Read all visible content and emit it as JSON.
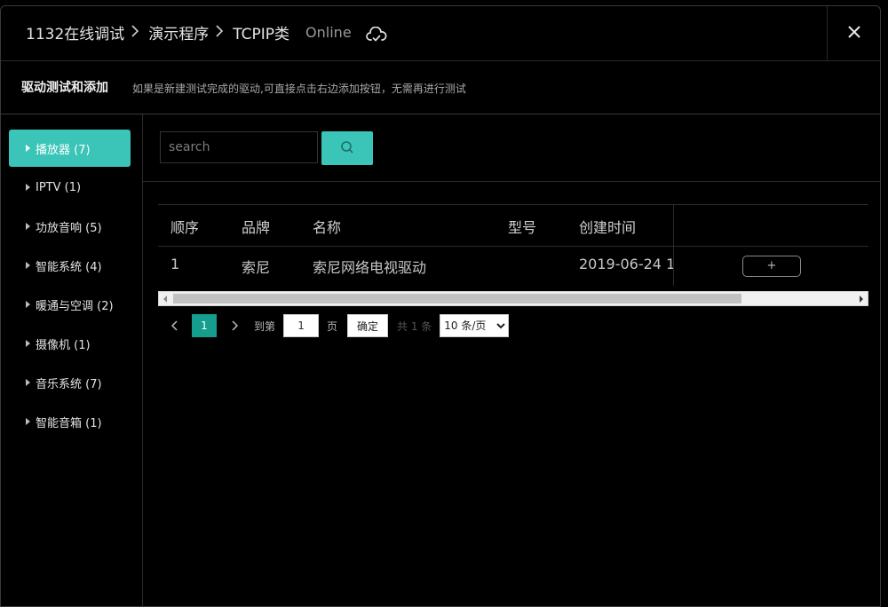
{
  "header": {
    "breadcrumbs": [
      "1132在线调试",
      "演示程序",
      "TCPIP类"
    ],
    "status": "Online",
    "cloud_icon": "cloud-check-icon",
    "close_icon": "close-icon"
  },
  "subheader": {
    "title": "驱动测试和添加",
    "description": "如果是新建测试完成的驱动,可直接点击右边添加按钮，无需再进行测试"
  },
  "sidebar": {
    "items": [
      {
        "label": "播放器 (7)",
        "active": true
      },
      {
        "label": "IPTV (1)",
        "active": false
      },
      {
        "label": "功放音响 (5)",
        "active": false
      },
      {
        "label": "智能系统 (4)",
        "active": false
      },
      {
        "label": "暖通与空调 (2)",
        "active": false
      },
      {
        "label": "摄像机 (1)",
        "active": false
      },
      {
        "label": "音乐系统 (7)",
        "active": false
      },
      {
        "label": "智能音箱 (1)",
        "active": false
      }
    ]
  },
  "search": {
    "placeholder": "search",
    "value": "",
    "button_icon": "search-icon"
  },
  "table": {
    "columns": [
      "顺序",
      "品牌",
      "名称",
      "型号",
      "创建时间"
    ],
    "rows": [
      {
        "index": "1",
        "brand": "索尼",
        "name": "索尼网络电视驱动",
        "model": "",
        "created": "2019-06-24 1",
        "action": "+"
      }
    ]
  },
  "pagination": {
    "current_page": "1",
    "goto_label": "到第",
    "goto_value": "1",
    "page_label": "页",
    "confirm_label": "确定",
    "total_label": "共 1 条",
    "page_size": "10 条/页",
    "page_size_options": [
      "10 条/页"
    ]
  },
  "colors": {
    "accent": "#3ac5b8",
    "pager_active": "#159d8d",
    "background": "#000000"
  }
}
